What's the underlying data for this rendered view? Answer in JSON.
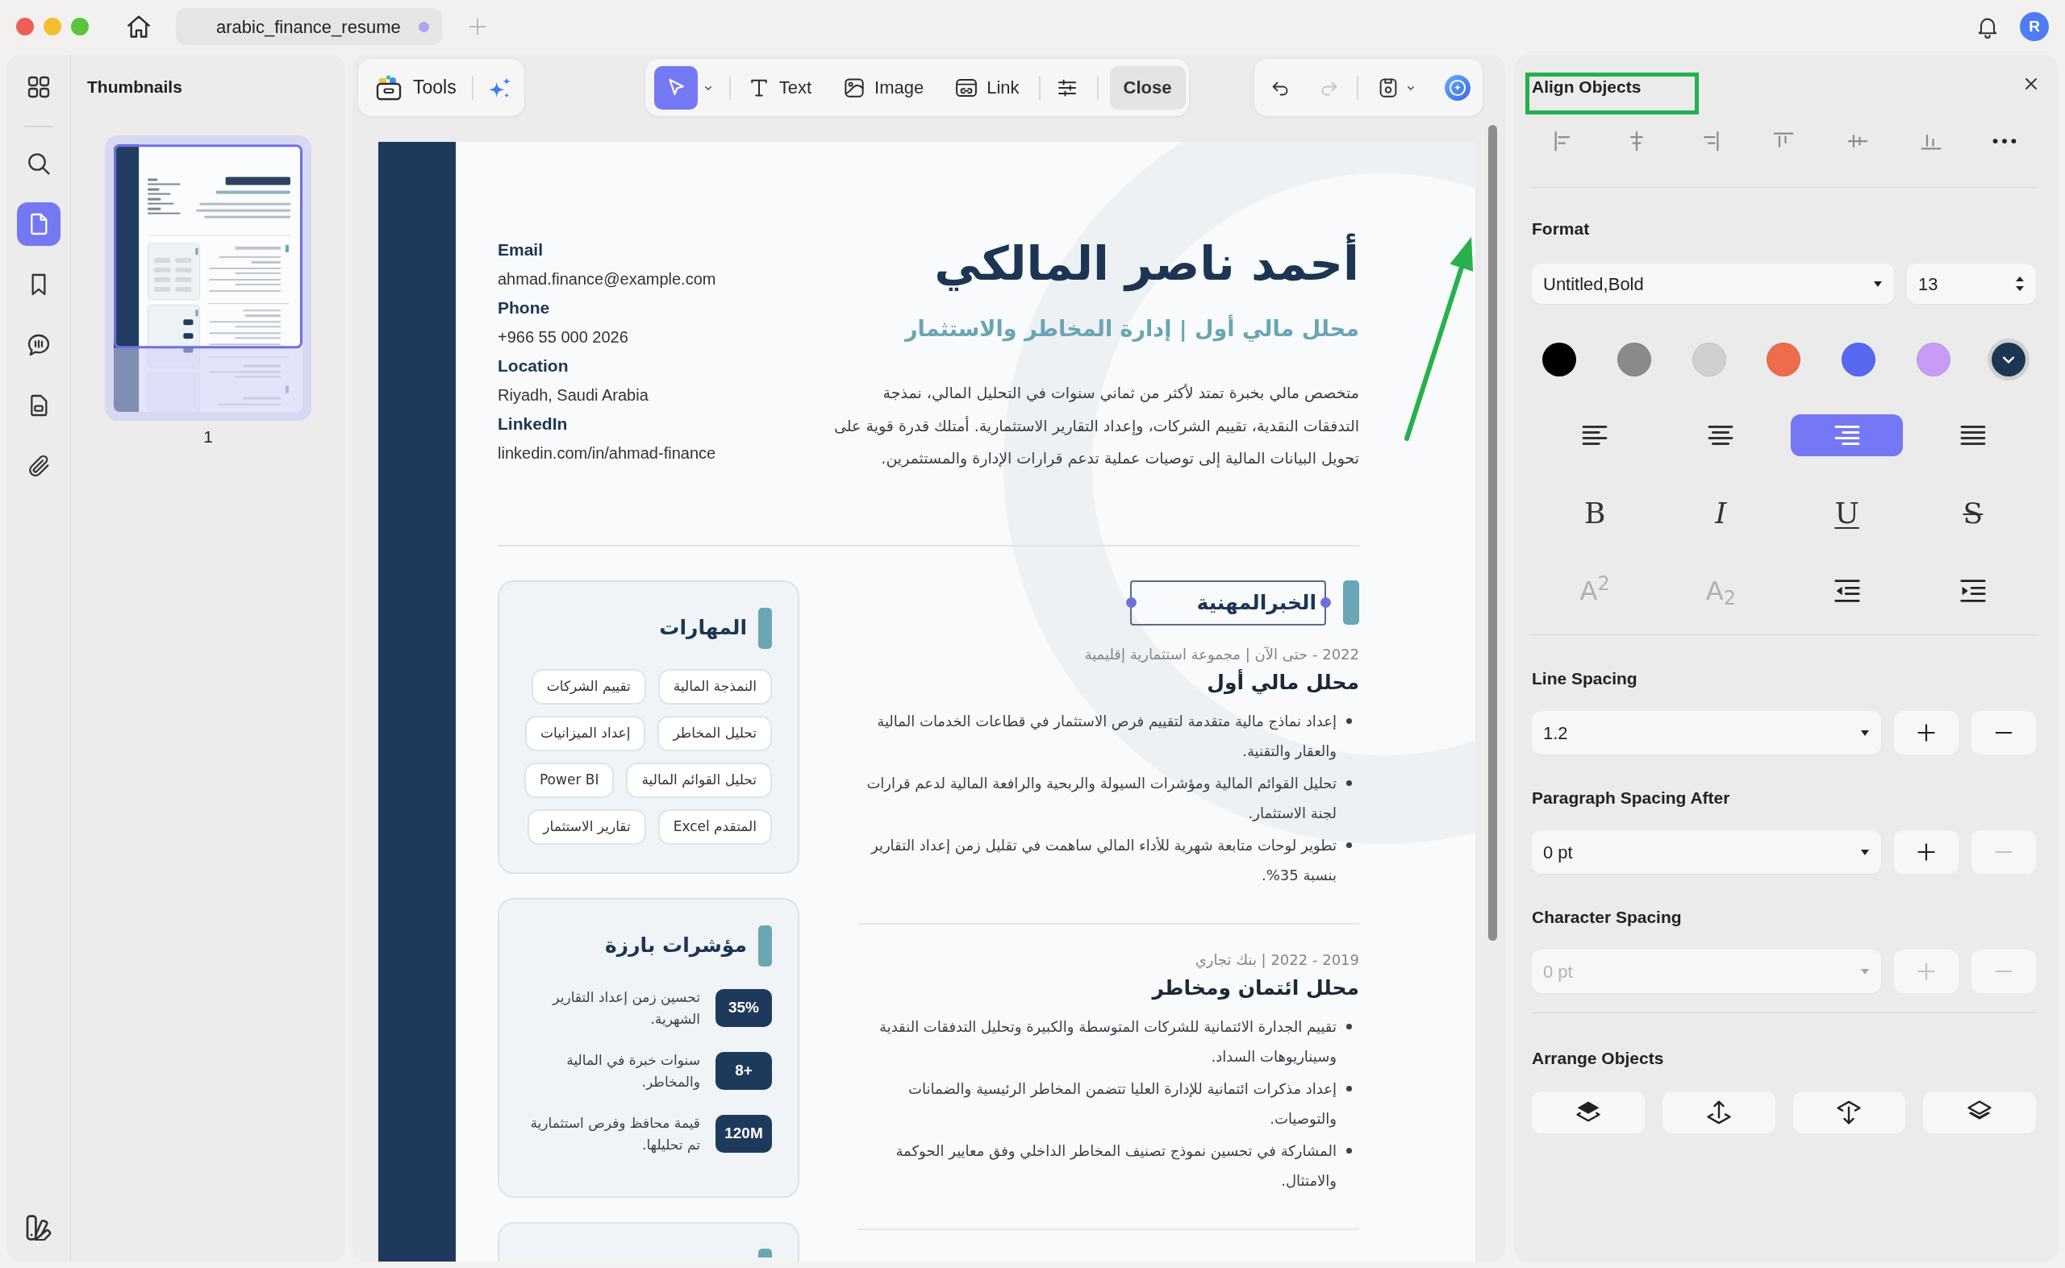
{
  "title_bar": {
    "tab_title": "arabic_finance_resume",
    "tab_modified": true,
    "user_initial": "R"
  },
  "sidebar": {
    "items": [
      {
        "selected": false
      },
      {
        "selected": false
      },
      {
        "selected": true
      },
      {
        "selected": false
      },
      {
        "selected": false
      },
      {
        "selected": false
      },
      {
        "selected": false
      }
    ]
  },
  "thumbnails": {
    "title": "Thumbnails",
    "pages": [
      {
        "label": "1",
        "selected": true
      }
    ]
  },
  "toolbar": {
    "tools_label": "Tools",
    "modes": {
      "select": {
        "selected": true
      },
      "text": {
        "label": "Text",
        "selected": false
      },
      "image": {
        "label": "Image",
        "selected": false
      },
      "link": {
        "label": "Link",
        "selected": false
      }
    },
    "close_label": "Close",
    "undo_disabled": false,
    "redo_disabled": true
  },
  "document": {
    "contact": [
      {
        "label": "Email",
        "value": "ahmad.finance@example.com"
      },
      {
        "label": "Phone",
        "value": "+966 55 000 2026"
      },
      {
        "label": "Location",
        "value": "Riyadh, Saudi Arabia"
      },
      {
        "label": "LinkedIn",
        "value": "linkedin.com/in/ahmad-finance"
      }
    ],
    "name": "أحمد ناصر المالكي",
    "headline": "محلل مالي أول | إدارة المخاطر والاستثمار",
    "summary": "متخصص مالي بخبرة تمتد لأكثر من ثماني سنوات في التحليل المالي، نمذجة التدفقات النقدية، تقييم الشركات، وإعداد التقارير الاستثمارية. أمتلك قدرة قوية على تحويل البيانات المالية إلى توصيات عملية تدعم قرارات الإدارة والمستثمرين.",
    "skills": {
      "heading": "المهارات",
      "tags": [
        "النمذجة المالية",
        "تقييم الشركات",
        "تحليل المخاطر",
        "إعداد الميزانيات",
        "تحليل القوائم المالية",
        "Power BI",
        "Excel المتقدم",
        "تقارير الاستثمار"
      ]
    },
    "highlights": {
      "heading": "مؤشرات بارزة",
      "items": [
        {
          "value": "35%",
          "text": "تحسين زمن إعداد التقارير الشهرية."
        },
        {
          "value": "8+",
          "text": "سنوات خبرة في المالية والمخاطر."
        },
        {
          "value": "120M",
          "text": "قيمة محافظ وفرص استثمارية تم تحليلها."
        }
      ]
    },
    "experience": {
      "heading": "الخبرالمهنية",
      "heading_selected": true,
      "jobs": [
        {
          "meta": "2022 - حتى الآن | مجموعة استثمارية إقليمية",
          "title": "محلل مالي أول",
          "bullets": [
            "إعداد نماذج مالية متقدمة لتقييم فرص الاستثمار في قطاعات الخدمات المالية والعقار والتقنية.",
            "تحليل القوائم المالية ومؤشرات السيولة والربحية والرافعة المالية لدعم قرارات لجنة الاستثمار.",
            "تطوير لوحات متابعة شهرية للأداء المالي ساهمت في تقليل زمن إعداد التقارير بنسبة 35%."
          ]
        },
        {
          "meta": "2019 - 2022 | بنك تجاري",
          "title": "محلل ائتمان ومخاطر",
          "bullets": [
            "تقييم الجدارة الائتمانية للشركات المتوسطة والكبيرة وتحليل التدفقات النقدية وسيناريوهات السداد.",
            "إعداد مذكرات ائتمانية للإدارة العليا تتضمن المخاطر الرئيسية والضمانات والتوصيات.",
            "المشاركة في تحسين نموذج تصنيف المخاطر الداخلي وفق معايير الحوكمة والامتثال."
          ]
        }
      ]
    }
  },
  "properties": {
    "align_objects": {
      "title": "Align Objects",
      "buttons": [
        {
          "disabled": true
        },
        {
          "disabled": true
        },
        {
          "disabled": true
        },
        {
          "disabled": true
        },
        {
          "disabled": true
        },
        {
          "disabled": true
        },
        {
          "disabled": false
        }
      ]
    },
    "format": {
      "title": "Format",
      "font": "Untitled,Bold",
      "size": "13",
      "colors": [
        {
          "color": "#000000",
          "selected": false
        },
        {
          "color": "#8a8a8a",
          "selected": false
        },
        {
          "color": "#d0d0d0",
          "selected": false
        },
        {
          "color": "#ee6c4b",
          "selected": false
        },
        {
          "color": "#5669f0",
          "selected": false
        },
        {
          "color": "#c89cf6",
          "selected": false
        },
        {
          "color": "#1c3553",
          "selected": true
        }
      ],
      "alignment": [
        {
          "selected": false
        },
        {
          "selected": false
        },
        {
          "selected": true
        },
        {
          "selected": false
        }
      ],
      "styles": {
        "bold": "B",
        "italic": "I",
        "underline": "U",
        "strikethrough": "S"
      },
      "scripts": {
        "superscript": {
          "label": "A$^{2}$",
          "disabled": true
        },
        "subscript": {
          "label": "A$_{2}$",
          "disabled": true
        }
      }
    },
    "spacing": [
      {
        "label": "Line Spacing",
        "value": "1.2",
        "disabled": false,
        "plus_disabled": false,
        "minus_disabled": false
      },
      {
        "label": "Paragraph Spacing After",
        "value": "0 pt",
        "disabled": false,
        "plus_disabled": false,
        "minus_disabled": true
      },
      {
        "label": "Character Spacing",
        "value": "0 pt",
        "disabled": true,
        "plus_disabled": true,
        "minus_disabled": true
      }
    ],
    "arrange": {
      "title": "Arrange Objects"
    }
  }
}
